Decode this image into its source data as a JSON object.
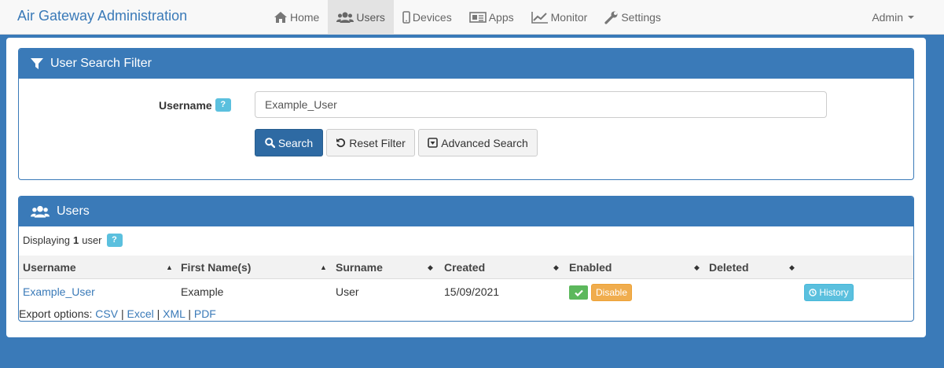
{
  "brand": "Air Gateway Administration",
  "nav": {
    "home": "Home",
    "users": "Users",
    "devices": "Devices",
    "apps": "Apps",
    "monitor": "Monitor",
    "settings": "Settings",
    "admin": "Admin"
  },
  "filter": {
    "title": "User Search Filter",
    "username_label": "Username",
    "help": "?",
    "username_value": "Example_User",
    "search_button": "Search",
    "reset_button": "Reset Filter",
    "advanced_button": "Advanced Search"
  },
  "users": {
    "title": "Users",
    "displaying_prefix": "Displaying",
    "count": "1",
    "displaying_suffix": "user",
    "help": "?",
    "columns": {
      "username": "Username",
      "first_names": "First Name(s)",
      "surname": "Surname",
      "created": "Created",
      "enabled": "Enabled",
      "deleted": "Deleted"
    },
    "rows": [
      {
        "username": "Example_User",
        "first_names": "Example",
        "surname": "User",
        "created": "15/09/2021",
        "disable_label": "Disable",
        "history_label": "History"
      }
    ],
    "export": {
      "label": "Export options:",
      "csv": "CSV",
      "excel": "Excel",
      "xml": "XML",
      "pdf": "PDF",
      "separator": "|"
    }
  },
  "colors": {
    "primary": "#3a7ab8",
    "success": "#5cb85c",
    "warning": "#f0ad4e",
    "info": "#5bc0de"
  }
}
